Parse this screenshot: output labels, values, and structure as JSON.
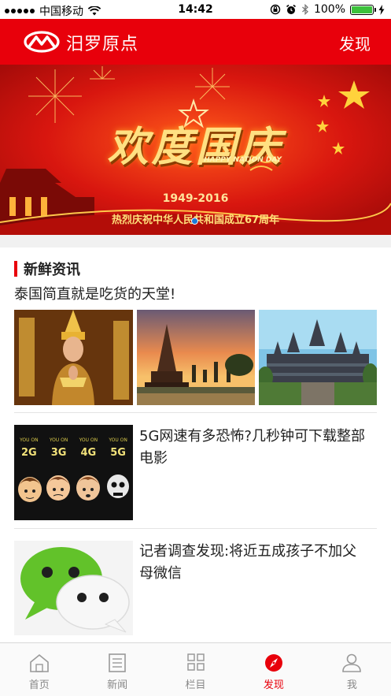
{
  "status_bar": {
    "carrier": "中国移动",
    "time": "14:42",
    "battery": "100%"
  },
  "navbar": {
    "title": "汨罗原点",
    "action_label": "发现"
  },
  "banner": {
    "headline": "欢度国庆",
    "tagline": "HAPPY NATION DAY",
    "years": "1949-2016",
    "caption": "热烈庆祝中华人民共和国成立67周年"
  },
  "section": {
    "title": "新鲜资讯"
  },
  "articles": [
    {
      "title": "泰国简直就是吃货的天堂!"
    },
    {
      "title": "5G网速有多恐怖?几秒钟可下载整部电影",
      "thumb_labels": [
        "2G",
        "3G",
        "4G",
        "5G"
      ],
      "thumb_caption": "YOU ON"
    },
    {
      "title": "记者调查发现:将近五成孩子不加父母微信"
    }
  ],
  "tabbar": {
    "active": "发现",
    "items": [
      {
        "label": "首页",
        "icon": "home-icon"
      },
      {
        "label": "新闻",
        "icon": "news-icon"
      },
      {
        "label": "栏目",
        "icon": "grid-icon"
      },
      {
        "label": "发现",
        "icon": "compass-icon"
      },
      {
        "label": "我",
        "icon": "person-icon"
      }
    ]
  },
  "colors": {
    "brand_red": "#e8000b",
    "indicator_blue": "#1a7bd8",
    "battery_green": "#3cc13b"
  }
}
